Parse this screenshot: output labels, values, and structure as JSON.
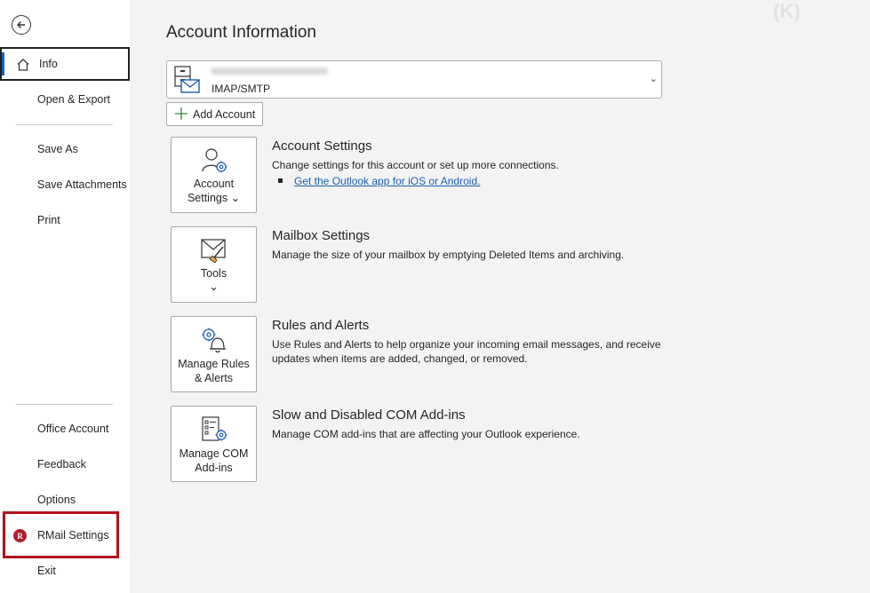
{
  "sidebar": {
    "back_label": "Back",
    "items": [
      {
        "label": "Info"
      },
      {
        "label": "Open & Export"
      },
      {
        "label": "Save As"
      },
      {
        "label": "Save Attachments"
      },
      {
        "label": "Print"
      },
      {
        "label": "Office Account"
      },
      {
        "label": "Feedback"
      },
      {
        "label": "Options"
      },
      {
        "label": "RMail Settings"
      },
      {
        "label": "Exit"
      }
    ],
    "rmail_icon_letter": "R"
  },
  "main": {
    "title": "Account Information",
    "account": {
      "type": "IMAP/SMTP",
      "chevron": "⌄"
    },
    "add_account_label": "Add Account",
    "sections": [
      {
        "tile_line1": "Account",
        "tile_line2": "Settings ⌄",
        "title": "Account Settings",
        "description": "Change settings for this account or set up more connections.",
        "link": "Get the Outlook app for iOS or Android."
      },
      {
        "tile_line1": "Tools",
        "tile_line2": "⌄",
        "title": "Mailbox Settings",
        "description": "Manage the size of your mailbox by emptying Deleted Items and archiving."
      },
      {
        "tile_line1": "Manage Rules",
        "tile_line2": "& Alerts",
        "title": "Rules and Alerts",
        "description": "Use Rules and Alerts to help organize your incoming email messages, and receive updates when items are added, changed, or removed."
      },
      {
        "tile_line1": "Manage COM",
        "tile_line2": "Add-ins",
        "title": "Slow and Disabled COM Add-ins",
        "description": "Manage COM add-ins that are affecting your Outlook experience."
      }
    ]
  },
  "colors": {
    "accent": "#1a5fb4",
    "highlight": "#b3101c",
    "rmail": "#b01e2e"
  },
  "icons": [
    "back-arrow-icon",
    "home-icon",
    "rmail-logo-icon",
    "mailbox-icon",
    "plus-icon",
    "account-settings-icon",
    "tools-icon",
    "rules-alerts-icon",
    "com-addins-icon",
    "chevron-down-icon"
  ]
}
